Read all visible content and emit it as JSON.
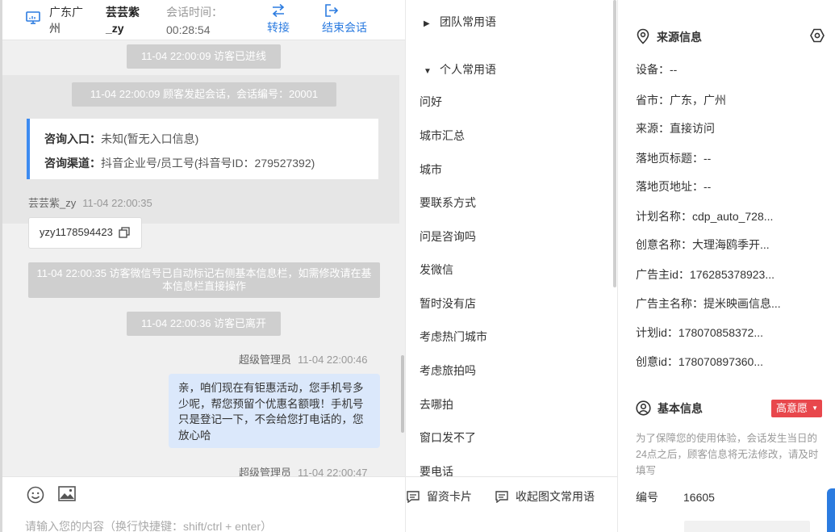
{
  "header": {
    "location": "广东广州",
    "visitor_name": "芸芸紫_zy",
    "session_time_label": "会话时间：",
    "session_time_value": "00:28:54",
    "transfer_label": "转接",
    "end_label": "结束会话"
  },
  "chat": {
    "system_top": "11-04 22:00:09 访客已进线",
    "session_start": "11-04 22:00:09 顾客发起会话，会话编号：20001",
    "entry": {
      "label": "咨询入口：",
      "value": "未知(暂无入口信息)",
      "channel_label": "咨询渠道：",
      "channel_value": "抖音企业号/员工号(抖音号ID：279527392)"
    },
    "visitor_msg": {
      "sender": "芸芸紫_zy",
      "time": "11-04 22:00:35",
      "text": "yzy1178594423"
    },
    "system_wechat": "11-04 22:00:35 访客微信号已自动标记右侧基本信息栏，如需修改请在基本信息栏直接操作",
    "system_left": "11-04 22:00:36 访客已离开",
    "admin_msg": {
      "sender": "超级管理员",
      "time": "11-04 22:00:46",
      "text": "亲，咱们现在有钜惠活动，您手机号多少呢，帮您预留个优惠名额哦！手机号只是登记一下，不会给您打电话的，您放心哈"
    },
    "admin_msg2": {
      "sender": "超级管理员",
      "time": "11-04 22:00:47"
    },
    "input_placeholder": "请输入您的内容（换行快捷键：shift/ctrl + enter）"
  },
  "phrases": {
    "team_group": "团队常用语",
    "personal_group": "个人常用语",
    "items": [
      "问好",
      "城市汇总",
      "城市",
      "要联系方式",
      "问是咨询吗",
      "发微信",
      "暂时没有店",
      "考虑热门城市",
      "考虑旅拍吗",
      "去哪拍",
      "窗口发不了",
      "要电话"
    ],
    "card_button": "留资卡片",
    "collapse_button": "收起图文常用语"
  },
  "source_info": {
    "title": "来源信息",
    "rows": [
      {
        "label": "设备：",
        "value": "--"
      },
      {
        "label": "省市：",
        "value": "广东，广州"
      },
      {
        "label": "来源：",
        "value": "直接访问"
      },
      {
        "label": "落地页标题：",
        "value": "--"
      },
      {
        "label": "落地页地址：",
        "value": "--"
      },
      {
        "label": "计划名称：",
        "value": "cdp_auto_728..."
      },
      {
        "label": "创意名称：",
        "value": "大理海鸥季开..."
      },
      {
        "label": "广告主id：",
        "value": "176285378923..."
      },
      {
        "label": "广告主名称：",
        "value": "提米映画信息..."
      },
      {
        "label": "计划id：",
        "value": "178070858372..."
      },
      {
        "label": "创意id：",
        "value": "178070897360..."
      }
    ]
  },
  "basic_info": {
    "title": "基本信息",
    "intent_badge": "高意愿",
    "note": "为了保障您的使用体验，会话发生当日的24点之后，顾客信息将无法修改，请及时填写",
    "id_label": "编号",
    "id_value": "16605"
  },
  "colors": {
    "accent": "#2b7be0",
    "admin_bubble": "#dbe8fb",
    "entry_border": "#3d8bf0",
    "intent_badge": "#e8474c",
    "system_pill": "#cfcfcf"
  }
}
